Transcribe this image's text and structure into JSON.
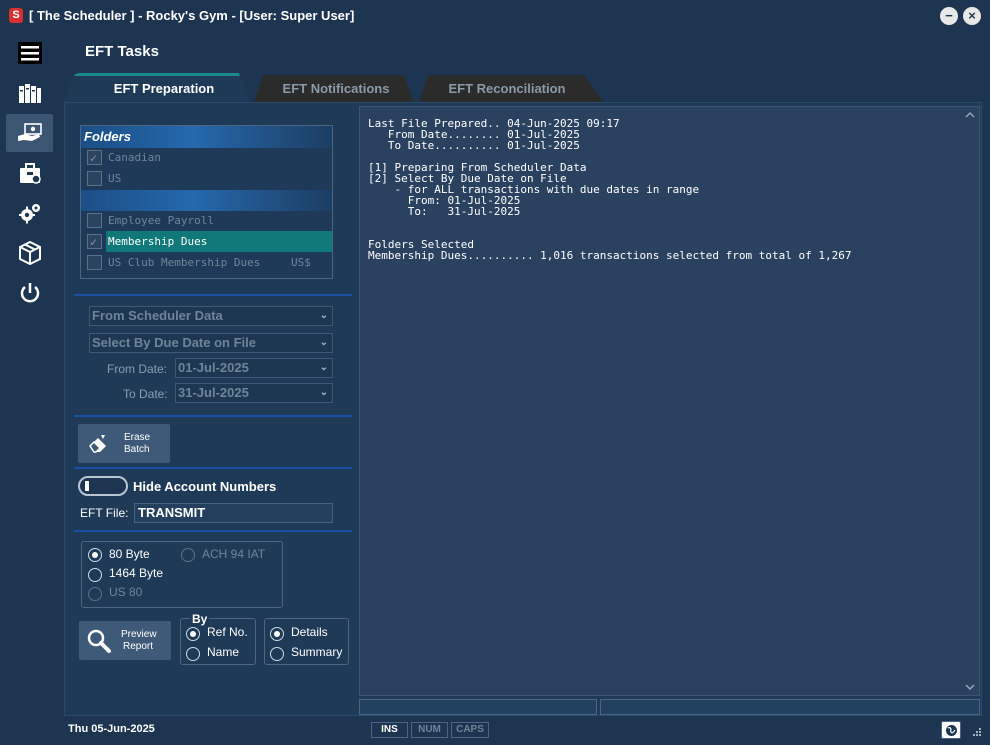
{
  "window": {
    "title": "[ The Scheduler ] - Rocky's Gym - [User: Super User]",
    "app_icon": "S",
    "minimize_label": "−",
    "close_label": "×"
  },
  "sidebar": {
    "items": [
      {
        "icon": "menu-icon"
      },
      {
        "icon": "books-icon"
      },
      {
        "icon": "payment-hand-icon"
      },
      {
        "icon": "briefcase-icon"
      },
      {
        "icon": "gears-icon"
      },
      {
        "icon": "package-icon"
      },
      {
        "icon": "power-icon"
      }
    ]
  },
  "page": {
    "title": "EFT Tasks"
  },
  "tabs": [
    {
      "label": "EFT Preparation"
    },
    {
      "label": "EFT Notifications"
    },
    {
      "label": "EFT Reconciliation"
    }
  ],
  "folders": {
    "header": "Folders",
    "items": [
      {
        "name": "Canadian",
        "suffix": "",
        "checked": true
      },
      {
        "name": "US",
        "suffix": "",
        "checked": false
      },
      {
        "name": "Employee Payroll",
        "suffix": "",
        "checked": false
      },
      {
        "name": "Membership Dues",
        "suffix": "",
        "checked": true
      },
      {
        "name": "US Club Membership Dues",
        "suffix": "US$",
        "checked": false
      }
    ]
  },
  "options": {
    "source": "From Scheduler Data",
    "select_by": "Select By Due Date on File",
    "from_date_label": "From Date:",
    "from_date": "01-Jul-2025",
    "to_date_label": "To Date:",
    "to_date": "31-Jul-2025"
  },
  "erase_button": {
    "line1": "Erase",
    "line2": "Batch"
  },
  "hide_account": {
    "label": "Hide Account Numbers"
  },
  "eft_file": {
    "label": "EFT File:",
    "value": "TRANSMIT"
  },
  "format": {
    "options": [
      "80 Byte",
      "1464 Byte",
      "US 80",
      "ACH 94 IAT"
    ]
  },
  "preview_button": {
    "line1": "Preview",
    "line2": "Report"
  },
  "by_group": {
    "legend": "By",
    "options": [
      "Ref No.",
      "Name"
    ]
  },
  "detail_group": {
    "options": [
      "Details",
      "Summary"
    ]
  },
  "log": {
    "lines": [
      "Last File Prepared.. 04-Jun-2025 09:17",
      "   From Date........ 01-Jul-2025",
      "   To Date.......... 01-Jul-2025",
      "",
      "[1] Preparing From Scheduler Data",
      "[2] Select By Due Date on File",
      "    - for ALL transactions with due dates in range",
      "      From: 01-Jul-2025",
      "      To:   31-Jul-2025",
      "",
      "",
      "Folders Selected",
      "Membership Dues.......... 1,016 transactions selected from total of 1,267"
    ]
  },
  "status": {
    "date": "Thu  05-Jun-2025",
    "keys": [
      "INS",
      "NUM",
      "CAPS"
    ]
  }
}
